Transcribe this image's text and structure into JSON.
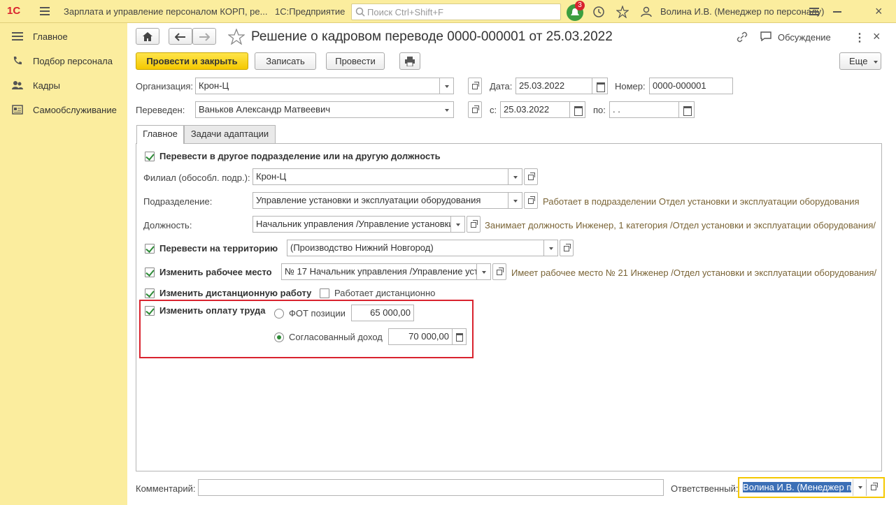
{
  "topbar": {
    "logo": "1С",
    "app_title": "Зарплата и управление персоналом КОРП, ре...",
    "platform": "1С:Предприятие",
    "search_placeholder": "Поиск Ctrl+Shift+F",
    "notifications_count": "3",
    "user": "Волина И.В. (Менеджер по персоналу)"
  },
  "sidebar": {
    "items": [
      {
        "label": "Главное",
        "icon": "menu-lines-icon"
      },
      {
        "label": "Подбор персонала",
        "icon": "phone-icon"
      },
      {
        "label": "Кадры",
        "icon": "people-icon"
      },
      {
        "label": "Самообслуживание",
        "icon": "card-icon"
      }
    ]
  },
  "document": {
    "title": "Решение о кадровом переводе 0000-000001 от 25.03.2022",
    "discussion": "Обсуждение"
  },
  "toolbar": {
    "post_close": "Провести и закрыть",
    "save": "Записать",
    "post": "Провести",
    "more": "Еще"
  },
  "header": {
    "org_label": "Организация:",
    "org_value": "Крон-Ц",
    "date_label": "Дата:",
    "date_value": "25.03.2022",
    "number_label": "Номер:",
    "number_value": "0000-000001",
    "transferred_label": "Переведен:",
    "transferred_value": "Ваньков Александр Матвеевич",
    "from_label": "с:",
    "from_value": "25.03.2022",
    "to_label": "по:",
    "to_value": " .  ."
  },
  "tabs": [
    "Главное",
    "Задачи адаптации"
  ],
  "main": {
    "transfer_dept_label": "Перевести в другое подразделение или на другую должность",
    "branch_label": "Филиал (обособл. подр.):",
    "branch_value": "Крон-Ц",
    "dept_label": "Подразделение:",
    "dept_value": "Управление установки и эксплуатации оборудования",
    "dept_hint": "Работает в подразделении Отдел установки и эксплуатации оборудования",
    "position_label": "Должность:",
    "position_value": "Начальник управления /Управление установки",
    "position_hint": "Занимает должность Инженер, 1 категория /Отдел установки и эксплуатации оборудования/",
    "territory_label": "Перевести на территорию",
    "territory_value": "(Производство Нижний Новгород)",
    "workplace_label": "Изменить рабочее место",
    "workplace_value": "№ 17 Начальник управления /Управление уст",
    "workplace_hint": "Имеет рабочее место № 21 Инженер /Отдел установки и эксплуатации оборудования/",
    "remote_label": "Изменить дистанционную работу",
    "remote_option": "Работает дистанционно",
    "pay_label": "Изменить оплату труда",
    "fot_label": "ФОТ позиции",
    "fot_value": "65 000,00",
    "agreed_label": "Согласованный доход",
    "agreed_value": "70 000,00"
  },
  "footer": {
    "comment_label": "Комментарий:",
    "responsible_label": "Ответственный:",
    "responsible_value": "Волина И.В. (Менеджер п"
  },
  "colors": {
    "accent": "#ffd700",
    "highlight": "#d9232e",
    "check": "#2e8b37"
  }
}
